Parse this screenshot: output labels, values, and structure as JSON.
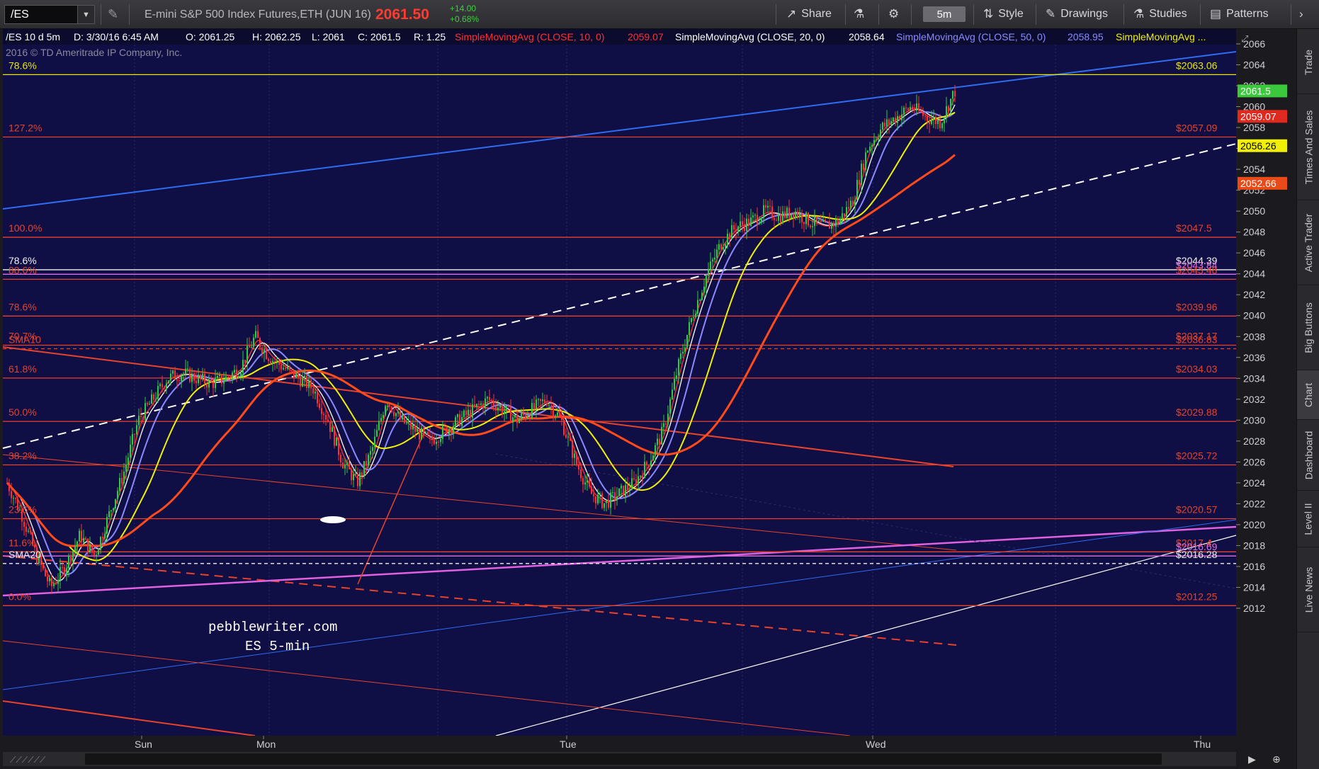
{
  "toolbar": {
    "symbol": "/ES",
    "description": "E-mini S&P 500 Index Futures,ETH (JUN 16)",
    "last_price": "2061.50",
    "change_abs": "+14.00",
    "change_pct": "+0.68%",
    "share_label": "Share",
    "timeframe": "5m",
    "style_label": "Style",
    "drawings_label": "Drawings",
    "studies_label": "Studies",
    "patterns_label": "Patterns"
  },
  "header": {
    "chart_id": "/ES 10 d 5m",
    "date": "D: 3/30/16 6:45 AM",
    "open": "O: 2061.25",
    "high": "H: 2062.25",
    "low": "L: 2061",
    "close": "C: 2061.5",
    "range": "R: 1.25",
    "sma10": "SimpleMovingAvg (CLOSE, 10, 0)",
    "sma10_val": "2059.07",
    "sma20": "SimpleMovingAvg (CLOSE, 20, 0)",
    "sma20_val": "2058.64",
    "sma50": "SimpleMovingAvg (CLOSE, 50, 0)",
    "sma50_val": "2058.95",
    "sma_more": "SimpleMovingAvg ...",
    "copyright": "2016 © TD Ameritrade IP Company, Inc."
  },
  "watermark": {
    "line1": "pebblewriter.com",
    "line2": "ES 5-min"
  },
  "price_axis": {
    "ticks": [
      "2066",
      "2064",
      "2062",
      "2060",
      "2058",
      "2056",
      "2054",
      "2052",
      "2050",
      "2048",
      "2046",
      "2044",
      "2042",
      "2040",
      "2038",
      "2036",
      "2034",
      "2032",
      "2030",
      "2028",
      "2026",
      "2024",
      "2022",
      "2020",
      "2018",
      "2016",
      "2014",
      "2012"
    ],
    "tags": [
      {
        "text": "2061.5",
        "color": "#3cc83c",
        "price": 2061.5
      },
      {
        "text": "2059.07",
        "color": "#e02a20",
        "price": 2059.07
      },
      {
        "text": "2056.26",
        "color": "#f0f000",
        "price": 2056.26
      },
      {
        "text": "2052.66",
        "color": "#e84a18",
        "price": 2052.66
      }
    ]
  },
  "time_axis": [
    "Sun",
    "Mon",
    "Tue",
    "Wed",
    "Thu"
  ],
  "fib_levels": [
    {
      "left": "78.6%",
      "right": "$2063.06",
      "price": 2063.06,
      "color": "#e8e800"
    },
    {
      "left": "127.2%",
      "right": "$2057.09",
      "price": 2057.09,
      "color": "#e8422a"
    },
    {
      "left": "100.0%",
      "right": "$2047.5",
      "price": 2047.5,
      "color": "#e8422a"
    },
    {
      "left": "78.6%",
      "right": "$2044.39",
      "price": 2044.39,
      "color": "#f0f0f0"
    },
    {
      "left": "",
      "right": "$2043.84",
      "price": 2043.96,
      "color": "#e070e0"
    },
    {
      "left": "88.6%",
      "right": "$2043.48",
      "price": 2043.48,
      "color": "#e8422a"
    },
    {
      "left": "78.6%",
      "right": "$2039.96",
      "price": 2039.96,
      "color": "#e8422a"
    },
    {
      "left": "70.7%",
      "right": "$2037.17",
      "price": 2037.17,
      "color": "#e8422a"
    },
    {
      "left": "SMA10",
      "right": "$2036.83",
      "price": 2036.83,
      "color": "#e8422a",
      "dashed": true
    },
    {
      "left": "61.8%",
      "right": "$2034.03",
      "price": 2034.03,
      "color": "#e8422a"
    },
    {
      "left": "50.0%",
      "right": "$2029.88",
      "price": 2029.88,
      "color": "#e8422a"
    },
    {
      "left": "38.2%",
      "right": "$2025.72",
      "price": 2025.72,
      "color": "#e8422a"
    },
    {
      "left": "23.6%",
      "right": "$2020.57",
      "price": 2020.57,
      "color": "#e8422a"
    },
    {
      "left": "11.6%",
      "right": "$2017.4",
      "price": 2017.4,
      "color": "#e8422a"
    },
    {
      "left": "",
      "right": "$2016.69",
      "price": 2017.0,
      "color": "#e070e0"
    },
    {
      "left": "SMA20",
      "right": "$2016.28",
      "price": 2016.28,
      "color": "#f0f0f0",
      "dashed": true
    },
    {
      "left": "0.0%",
      "right": "$2012.25",
      "price": 2012.25,
      "color": "#e8422a"
    }
  ],
  "sidebar": {
    "tabs": [
      "Trade",
      "Times And Sales",
      "Active Trader",
      "Big Buttons",
      "Chart",
      "Dashboard",
      "Level II",
      "Live News"
    ],
    "active": "Chart"
  },
  "colors": {
    "plot_bg": "#0f0f45",
    "sma10": "#ff3030",
    "sma20": "#ffffff",
    "sma50": "#8a8aff",
    "sma100": "#f0f000",
    "sma200": "#ff4a1a",
    "up_candle": "#2ecc40",
    "down_candle": "#ff3030"
  },
  "chart_data": {
    "type": "candlestick",
    "symbol": "/ES",
    "interval": "5m",
    "ylim": [
      2011,
      2067
    ],
    "x_labels": [
      "Sun",
      "Mon",
      "Tue",
      "Wed",
      "Thu"
    ],
    "close_path_approx": [
      2024,
      2021,
      2017,
      2014,
      2016,
      2019,
      2017,
      2021,
      2025,
      2030,
      2032,
      2034,
      2034.5,
      2034,
      2033.5,
      2034,
      2035,
      2038,
      2036,
      2035,
      2034,
      2033,
      2030,
      2026,
      2024,
      2027,
      2032,
      2030,
      2029,
      2028,
      2029,
      2030,
      2031,
      2032,
      2031,
      2030,
      2031,
      2032,
      2030,
      2026,
      2023,
      2022,
      2023,
      2024,
      2026,
      2029,
      2035,
      2040,
      2044,
      2047,
      2048.5,
      2049,
      2050,
      2049.5,
      2050,
      2049,
      2048.5,
      2049,
      2051,
      2056,
      2058,
      2059,
      2060,
      2059,
      2058.5,
      2061.5
    ]
  }
}
